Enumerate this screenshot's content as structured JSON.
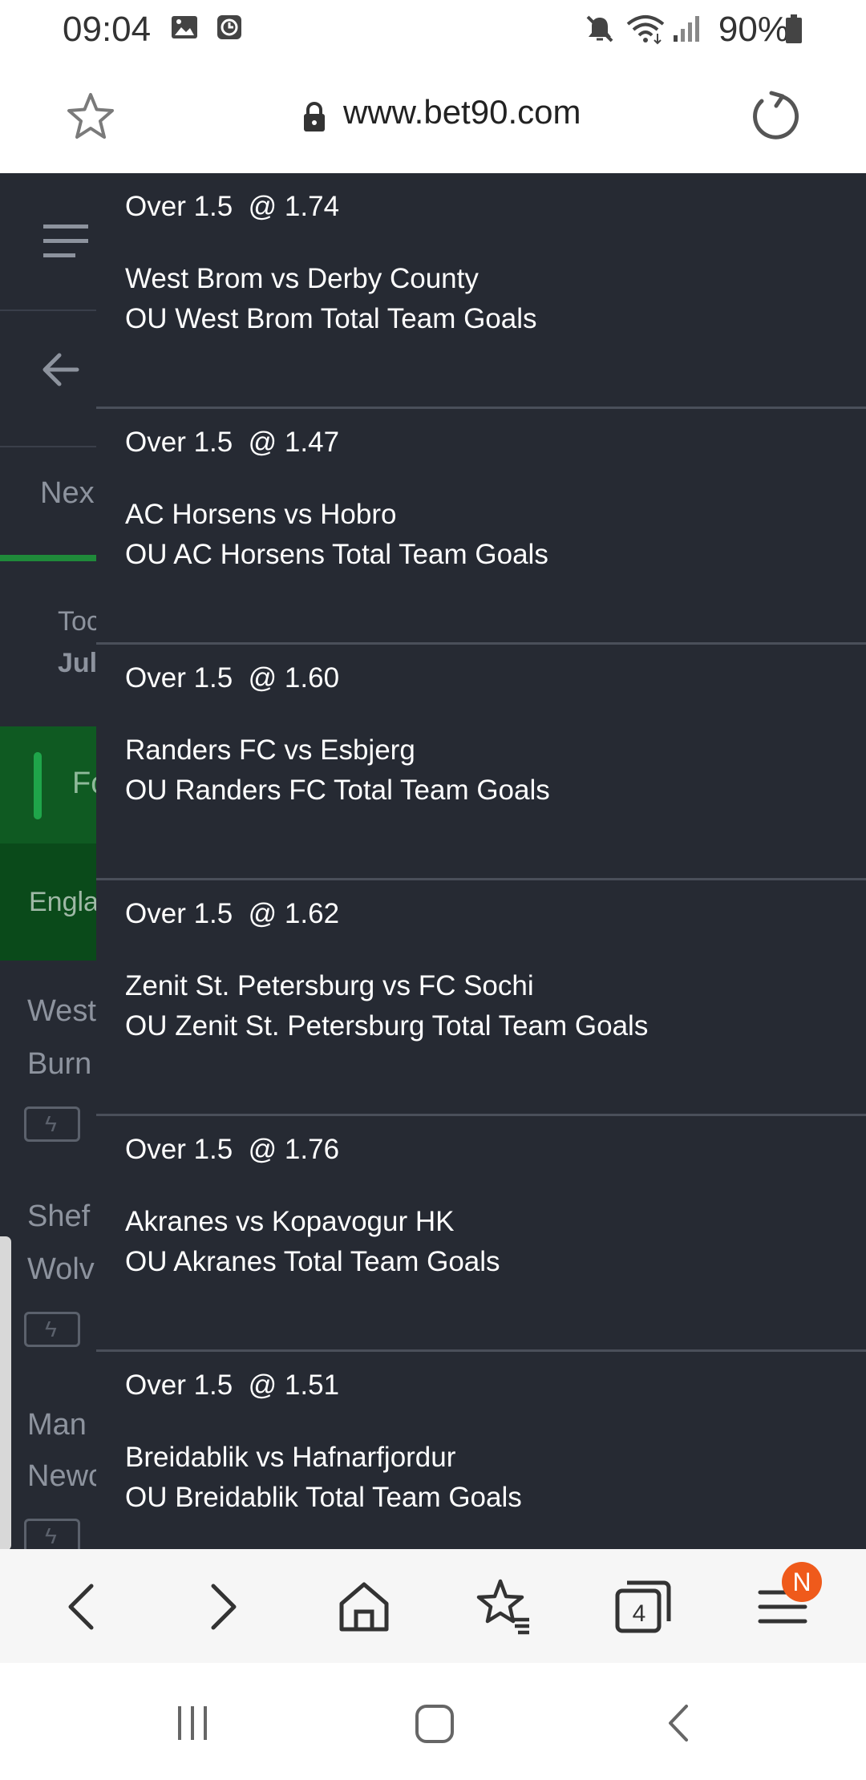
{
  "status_bar": {
    "time": "09:04",
    "battery": "90%",
    "icons": [
      "image-icon",
      "alarm-icon",
      "mute-icon",
      "wifi-icon",
      "signal-icon",
      "battery-icon"
    ]
  },
  "browser": {
    "url": "www.bet90.com"
  },
  "background_fragments": {
    "tab": "Nex",
    "date_top": "Toc",
    "date_bottom": "Jul",
    "sport": "Fo",
    "league": "Engla",
    "m1_a": "West",
    "m1_b": "Burn",
    "m2_a": "Shef",
    "m2_b": "Wolv",
    "m3_a": "Man",
    "m3_b": "Newc"
  },
  "bets": [
    {
      "selection": "Over 1.5  @ 1.74",
      "match": "West Brom vs Derby County",
      "market": "OU West Brom Total Team Goals"
    },
    {
      "selection": "Over 1.5  @ 1.47",
      "match": "AC Horsens vs Hobro",
      "market": "OU AC Horsens Total Team Goals"
    },
    {
      "selection": "Over 1.5  @ 1.60",
      "match": "Randers FC vs Esbjerg",
      "market": "OU Randers FC Total Team Goals"
    },
    {
      "selection": "Over 1.5  @ 1.62",
      "match": "Zenit St. Petersburg vs FC Sochi",
      "market": "OU Zenit St. Petersburg Total Team Goals"
    },
    {
      "selection": "Over 1.5  @ 1.76",
      "match": "Akranes vs Kopavogur HK",
      "market": "OU Akranes Total Team Goals"
    },
    {
      "selection": "Over 1.5  @ 1.51",
      "match": "Breidablik vs Hafnarfjordur",
      "market": "OU Breidablik Total Team Goals"
    }
  ],
  "bottom_nav": {
    "tabs_count": "4",
    "menu_badge": "N"
  },
  "colors": {
    "page_bg": "#262a33",
    "accent_green": "#1f8a3a",
    "badge": "#ef5a1b"
  }
}
